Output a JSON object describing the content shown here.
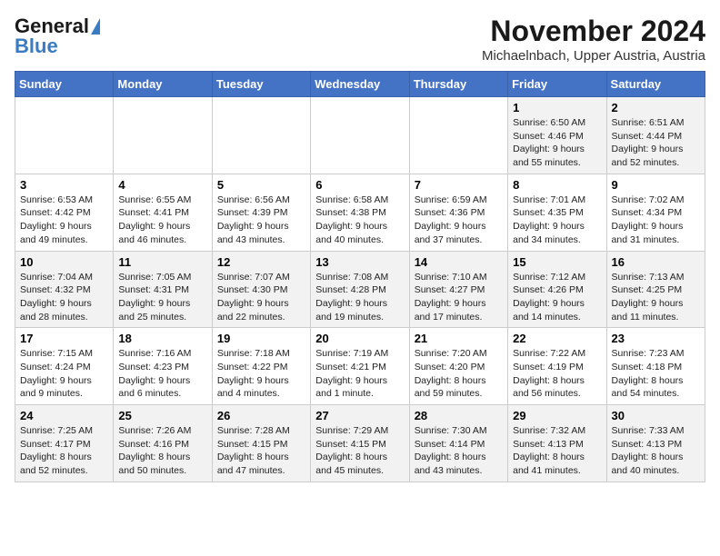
{
  "logo": {
    "line1": "General",
    "line2": "Blue"
  },
  "header": {
    "month": "November 2024",
    "location": "Michaelnbach, Upper Austria, Austria"
  },
  "weekdays": [
    "Sunday",
    "Monday",
    "Tuesday",
    "Wednesday",
    "Thursday",
    "Friday",
    "Saturday"
  ],
  "weeks": [
    [
      {
        "day": "",
        "info": ""
      },
      {
        "day": "",
        "info": ""
      },
      {
        "day": "",
        "info": ""
      },
      {
        "day": "",
        "info": ""
      },
      {
        "day": "",
        "info": ""
      },
      {
        "day": "1",
        "info": "Sunrise: 6:50 AM\nSunset: 4:46 PM\nDaylight: 9 hours\nand 55 minutes."
      },
      {
        "day": "2",
        "info": "Sunrise: 6:51 AM\nSunset: 4:44 PM\nDaylight: 9 hours\nand 52 minutes."
      }
    ],
    [
      {
        "day": "3",
        "info": "Sunrise: 6:53 AM\nSunset: 4:42 PM\nDaylight: 9 hours\nand 49 minutes."
      },
      {
        "day": "4",
        "info": "Sunrise: 6:55 AM\nSunset: 4:41 PM\nDaylight: 9 hours\nand 46 minutes."
      },
      {
        "day": "5",
        "info": "Sunrise: 6:56 AM\nSunset: 4:39 PM\nDaylight: 9 hours\nand 43 minutes."
      },
      {
        "day": "6",
        "info": "Sunrise: 6:58 AM\nSunset: 4:38 PM\nDaylight: 9 hours\nand 40 minutes."
      },
      {
        "day": "7",
        "info": "Sunrise: 6:59 AM\nSunset: 4:36 PM\nDaylight: 9 hours\nand 37 minutes."
      },
      {
        "day": "8",
        "info": "Sunrise: 7:01 AM\nSunset: 4:35 PM\nDaylight: 9 hours\nand 34 minutes."
      },
      {
        "day": "9",
        "info": "Sunrise: 7:02 AM\nSunset: 4:34 PM\nDaylight: 9 hours\nand 31 minutes."
      }
    ],
    [
      {
        "day": "10",
        "info": "Sunrise: 7:04 AM\nSunset: 4:32 PM\nDaylight: 9 hours\nand 28 minutes."
      },
      {
        "day": "11",
        "info": "Sunrise: 7:05 AM\nSunset: 4:31 PM\nDaylight: 9 hours\nand 25 minutes."
      },
      {
        "day": "12",
        "info": "Sunrise: 7:07 AM\nSunset: 4:30 PM\nDaylight: 9 hours\nand 22 minutes."
      },
      {
        "day": "13",
        "info": "Sunrise: 7:08 AM\nSunset: 4:28 PM\nDaylight: 9 hours\nand 19 minutes."
      },
      {
        "day": "14",
        "info": "Sunrise: 7:10 AM\nSunset: 4:27 PM\nDaylight: 9 hours\nand 17 minutes."
      },
      {
        "day": "15",
        "info": "Sunrise: 7:12 AM\nSunset: 4:26 PM\nDaylight: 9 hours\nand 14 minutes."
      },
      {
        "day": "16",
        "info": "Sunrise: 7:13 AM\nSunset: 4:25 PM\nDaylight: 9 hours\nand 11 minutes."
      }
    ],
    [
      {
        "day": "17",
        "info": "Sunrise: 7:15 AM\nSunset: 4:24 PM\nDaylight: 9 hours\nand 9 minutes."
      },
      {
        "day": "18",
        "info": "Sunrise: 7:16 AM\nSunset: 4:23 PM\nDaylight: 9 hours\nand 6 minutes."
      },
      {
        "day": "19",
        "info": "Sunrise: 7:18 AM\nSunset: 4:22 PM\nDaylight: 9 hours\nand 4 minutes."
      },
      {
        "day": "20",
        "info": "Sunrise: 7:19 AM\nSunset: 4:21 PM\nDaylight: 9 hours\nand 1 minute."
      },
      {
        "day": "21",
        "info": "Sunrise: 7:20 AM\nSunset: 4:20 PM\nDaylight: 8 hours\nand 59 minutes."
      },
      {
        "day": "22",
        "info": "Sunrise: 7:22 AM\nSunset: 4:19 PM\nDaylight: 8 hours\nand 56 minutes."
      },
      {
        "day": "23",
        "info": "Sunrise: 7:23 AM\nSunset: 4:18 PM\nDaylight: 8 hours\nand 54 minutes."
      }
    ],
    [
      {
        "day": "24",
        "info": "Sunrise: 7:25 AM\nSunset: 4:17 PM\nDaylight: 8 hours\nand 52 minutes."
      },
      {
        "day": "25",
        "info": "Sunrise: 7:26 AM\nSunset: 4:16 PM\nDaylight: 8 hours\nand 50 minutes."
      },
      {
        "day": "26",
        "info": "Sunrise: 7:28 AM\nSunset: 4:15 PM\nDaylight: 8 hours\nand 47 minutes."
      },
      {
        "day": "27",
        "info": "Sunrise: 7:29 AM\nSunset: 4:15 PM\nDaylight: 8 hours\nand 45 minutes."
      },
      {
        "day": "28",
        "info": "Sunrise: 7:30 AM\nSunset: 4:14 PM\nDaylight: 8 hours\nand 43 minutes."
      },
      {
        "day": "29",
        "info": "Sunrise: 7:32 AM\nSunset: 4:13 PM\nDaylight: 8 hours\nand 41 minutes."
      },
      {
        "day": "30",
        "info": "Sunrise: 7:33 AM\nSunset: 4:13 PM\nDaylight: 8 hours\nand 40 minutes."
      }
    ]
  ]
}
